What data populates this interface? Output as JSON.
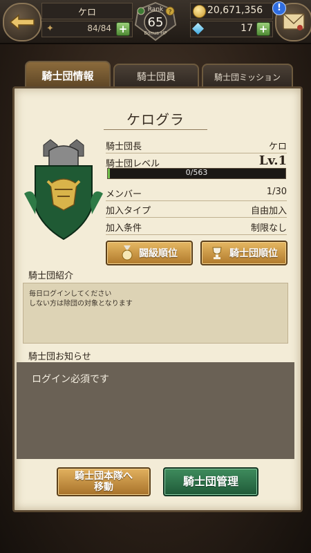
{
  "header": {
    "player_name": "ケロ",
    "stamina": "84/84",
    "rank_label": "Rank",
    "rank_value": "65",
    "rank_sub": "Bonus HP",
    "gold": "20,671,356",
    "gems": "17",
    "back_icon": "back-arrow-icon",
    "mail_icon": "mail-icon"
  },
  "tabs": [
    {
      "label": "騎士団情報",
      "active": true
    },
    {
      "label": "騎士団員",
      "active": false
    },
    {
      "label": "騎士団ミッション",
      "active": false
    }
  ],
  "clan": {
    "name": "ケログラ",
    "leader_label": "騎士団長",
    "leader_value": "ケロ",
    "level_label": "騎士団レベル",
    "level_value": "Lv.1",
    "exp_text": "0/563",
    "exp_progress": 0,
    "members_label": "メンバー",
    "members_value": "1/30",
    "join_type_label": "加入タイプ",
    "join_type_value": "自由加入",
    "join_cond_label": "加入条件",
    "join_cond_value": "制限なし"
  },
  "buttons": {
    "battle_rank": "闘級順位",
    "clan_rank": "騎士団順位",
    "move_main_line1": "騎士団本隊へ",
    "move_main_line2": "移動",
    "manage": "騎士団管理"
  },
  "intro": {
    "heading": "騎士団紹介",
    "line1": "毎日ログインしてください",
    "line2": "しない方は除団の対象となります"
  },
  "notice": {
    "heading": "騎士団お知らせ",
    "text": "ログイン必須です"
  },
  "colors": {
    "accent_gold": "#c99a2e",
    "button_green": "#2f7a4a",
    "panel_bg": "#f3ecd7"
  }
}
